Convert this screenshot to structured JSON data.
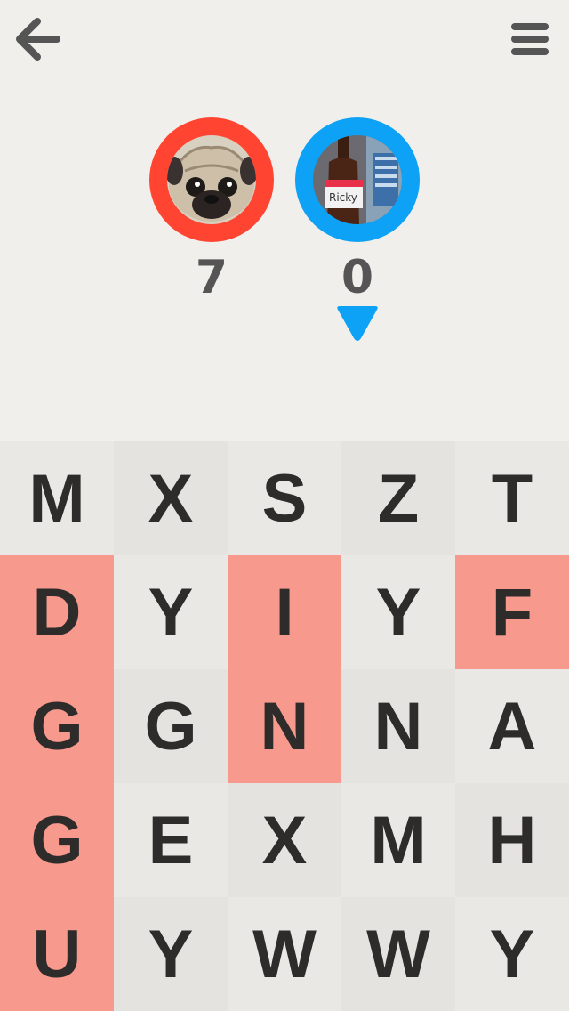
{
  "header": {
    "back_icon": "arrow-left-icon",
    "menu_icon": "hamburger-menu-icon"
  },
  "players": [
    {
      "score": "7",
      "ring_color": "#ff4532",
      "avatar": "pug-photo"
    },
    {
      "score": "0",
      "ring_color": "#0da2f5",
      "avatar": "bottle-photo",
      "current_turn": true
    }
  ],
  "colors": {
    "background": "#f0efec",
    "tile_light": "#e9e8e5",
    "tile_dark": "#e4e3df",
    "red_owned": "#f7998c",
    "letter": "#2e2b2b",
    "turn_indicator": "#0da2f5"
  },
  "board": {
    "rows": [
      [
        "M",
        "X",
        "S",
        "Z",
        "T"
      ],
      [
        "D",
        "Y",
        "I",
        "Y",
        "F"
      ],
      [
        "G",
        "G",
        "N",
        "N",
        "A"
      ],
      [
        "G",
        "E",
        "X",
        "M",
        "H"
      ],
      [
        "U",
        "Y",
        "W",
        "W",
        "Y"
      ]
    ],
    "owners": [
      [
        "none",
        "none",
        "none",
        "none",
        "none"
      ],
      [
        "red",
        "none",
        "red",
        "none",
        "red"
      ],
      [
        "red",
        "none",
        "red",
        "none",
        "none"
      ],
      [
        "red",
        "none",
        "none",
        "none",
        "none"
      ],
      [
        "red",
        "none",
        "none",
        "none",
        "none"
      ]
    ]
  }
}
